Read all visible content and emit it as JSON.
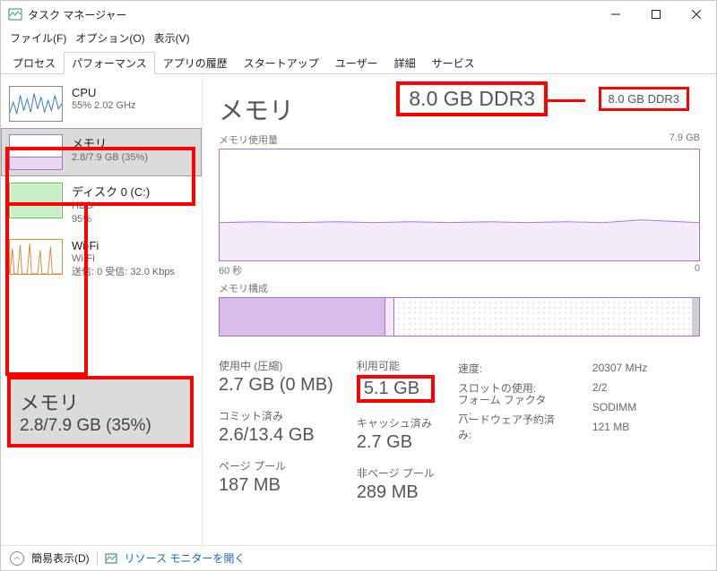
{
  "window": {
    "title": "タスク マネージャー"
  },
  "menu": {
    "file": "ファイル(F)",
    "options": "オプション(O)",
    "view": "表示(V)"
  },
  "tabs": {
    "items": [
      "プロセス",
      "パフォーマンス",
      "アプリの履歴",
      "スタートアップ",
      "ユーザー",
      "詳細",
      "サービス"
    ],
    "active_index": 1
  },
  "sidebar": {
    "items": [
      {
        "title": "CPU",
        "sub": "55%  2.02 GHz"
      },
      {
        "title": "メモリ",
        "sub": "2.8/7.9 GB (35%)"
      },
      {
        "title": "ディスク 0 (C:)",
        "sub1": "HDD",
        "sub2": "95%"
      },
      {
        "title": "Wi-Fi",
        "sub1": "Wi-Fi",
        "sub2": "送信: 0 受信: 32.0 Kbps"
      }
    ],
    "selected_index": 1
  },
  "callout_memory": {
    "line1": "メモリ",
    "line2": "2.8/7.9 GB (35%)"
  },
  "detail": {
    "title": "メモリ",
    "spec_main": "8.0 GB DDR3",
    "spec_echo": "8.0 GB DDR3",
    "usage_chart_label": "メモリ使用量",
    "usage_chart_max": "7.9 GB",
    "usage_chart_xleft": "60 秒",
    "usage_chart_xright": "0",
    "mcomp_label": "メモリ構成",
    "stats": {
      "in_use_label": "使用中 (圧縮)",
      "in_use_value": "2.7 GB (0 MB)",
      "avail_label": "利用可能",
      "avail_value": "5.1 GB",
      "commit_label": "コミット済み",
      "commit_value": "2.6/13.4 GB",
      "cached_label": "キャッシュ済み",
      "cached_value": "2.7 GB",
      "paged_label": "ページ プール",
      "paged_value": "187 MB",
      "nonpaged_label": "非ページ プール",
      "nonpaged_value": "289 MB"
    },
    "right": {
      "speed_k": "速度:",
      "speed_v": "20307 MHz",
      "slots_k": "スロットの使用:",
      "slots_v": "2/2",
      "form_k": "フォーム ファクター:",
      "form_v": "SODIMM",
      "hwres_k": "ハードウェア予約済み:",
      "hwres_v": "121 MB"
    }
  },
  "footer": {
    "simple_view": "簡易表示(D)",
    "resmon": "リソース モニターを開く"
  },
  "chart_data": {
    "type": "area",
    "title": "メモリ使用量",
    "x_range_seconds": [
      60,
      0
    ],
    "ylim": [
      0,
      7.9
    ],
    "y_unit": "GB",
    "approx_constant_value": 2.8,
    "series": [
      {
        "name": "memory_used_gb",
        "values": [
          2.75,
          2.78,
          2.8,
          2.79,
          2.78,
          2.8,
          2.81,
          2.8,
          2.79,
          2.8,
          2.82,
          2.8,
          2.79,
          2.78,
          2.8,
          2.81
        ]
      }
    ],
    "composition_bar": {
      "segments": [
        {
          "name": "in_use",
          "fraction": 0.345
        },
        {
          "name": "modified",
          "fraction": 0.02
        },
        {
          "name": "standby",
          "fraction": 0.62
        },
        {
          "name": "free",
          "fraction": 0.015
        }
      ],
      "total_gb": 7.9
    }
  },
  "annotation_color": "#ff0000",
  "accent_color": "#a972c6"
}
